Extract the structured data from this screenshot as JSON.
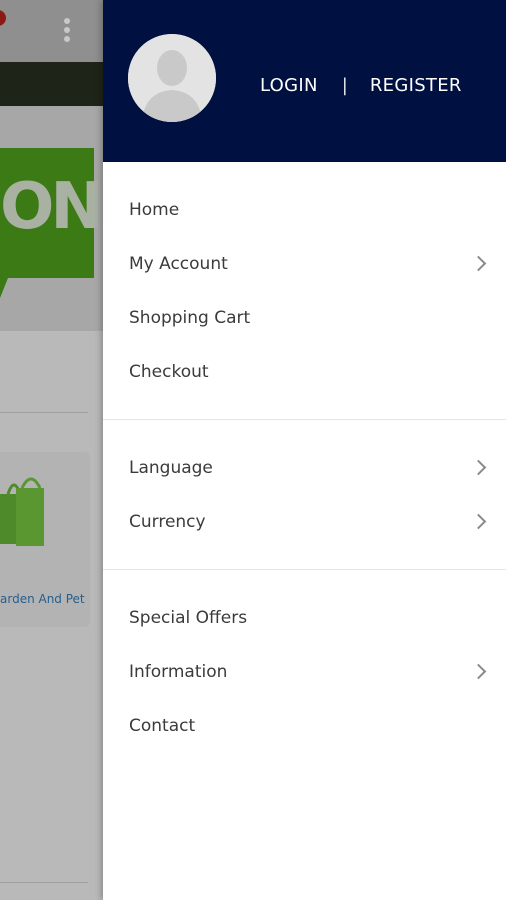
{
  "background": {
    "banner_text": "ON",
    "category_label": "arden And Pet"
  },
  "drawer": {
    "header": {
      "login_label": "LOGIN",
      "separator": "|",
      "register_label": "REGISTER"
    },
    "sections": [
      [
        {
          "label": "Home",
          "has_chevron": false
        },
        {
          "label": "My Account",
          "has_chevron": true
        },
        {
          "label": "Shopping Cart",
          "has_chevron": false
        },
        {
          "label": "Checkout",
          "has_chevron": false
        }
      ],
      [
        {
          "label": "Language",
          "has_chevron": true
        },
        {
          "label": "Currency",
          "has_chevron": true
        }
      ],
      [
        {
          "label": "Special Offers",
          "has_chevron": false
        },
        {
          "label": "Information",
          "has_chevron": true
        },
        {
          "label": "Contact",
          "has_chevron": false
        }
      ]
    ]
  },
  "colors": {
    "header_bg": "#001141",
    "overlay_gray": "#b9b9b9",
    "menu_text": "#3b3b3b"
  },
  "icons": {
    "avatar": "user-silhouette-icon",
    "chevron": "chevron-right-icon",
    "overflow": "kebab-menu-icon"
  }
}
